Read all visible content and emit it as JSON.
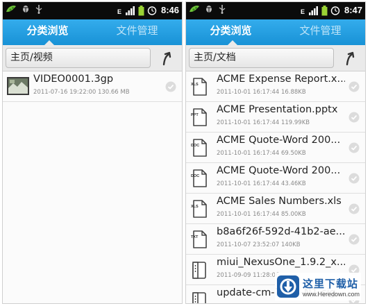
{
  "screens": [
    {
      "status_time": "8:46",
      "tabs": [
        "分类浏览",
        "文件管理"
      ],
      "active_tab": 0,
      "path": "主页/视频",
      "files": [
        {
          "type": "video",
          "name": "VIDEO0001.3gp",
          "meta": "2011-07-16 19:22:00 130.66 MB"
        }
      ]
    },
    {
      "status_time": "8:47",
      "tabs": [
        "分类浏览",
        "文件管理"
      ],
      "active_tab": 0,
      "path": "主页/文档",
      "files": [
        {
          "type": "XLS",
          "name": "ACME Expense Report.x...",
          "meta": "2011-10-01 16:17:44 16.88KB"
        },
        {
          "type": "PPT",
          "name": "ACME Presentation.pptx",
          "meta": "2011-10-01 16:17:44 119.99KB"
        },
        {
          "type": "DOC",
          "name": "ACME Quote-Word 200...",
          "meta": "2011-10-01 16:17:44 69.50KB"
        },
        {
          "type": "DOC",
          "name": "ACME Quote-Word 200...",
          "meta": "2011-10-01 16:17:44 43.46KB"
        },
        {
          "type": "XLS",
          "name": "ACME Sales Numbers.xls",
          "meta": "2011-10-01 16:17:44 85.00KB"
        },
        {
          "type": "TXT",
          "name": "b8a6f26f-592d-41b2-ae...",
          "meta": "2011-10-07 23:52:07 140KB"
        },
        {
          "type": "ZIP",
          "name": "miui_NexusOne_1.9.2_x...",
          "meta": "2011-09-09 11:28:06"
        },
        {
          "type": "ZIP",
          "name": "update-cm-7.0.3-N1-sig...",
          "meta": ""
        }
      ]
    }
  ],
  "watermark": {
    "cn": "这里下载站",
    "url": "www.Heredown.com"
  },
  "colors": {
    "tabbar": "#1d9fe2",
    "statusbar": "#0b0b0b",
    "watermark_text": "#1f5fa8"
  }
}
